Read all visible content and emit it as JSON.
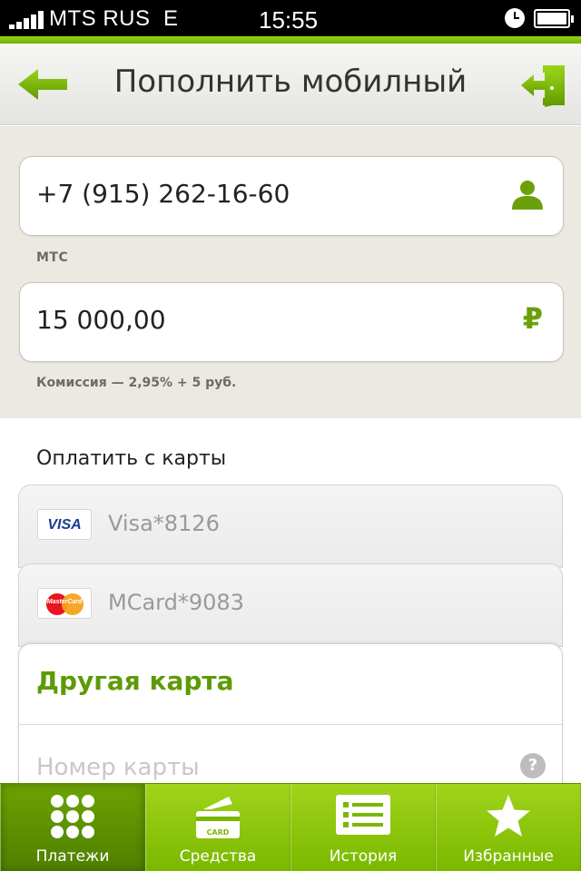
{
  "status_bar": {
    "carrier": "MTS RUS",
    "network": "E",
    "time": "15:55"
  },
  "nav": {
    "title": "Пополнить мобилный"
  },
  "form": {
    "phone_value": "+7 (915) 262-16-60",
    "operator": "МТС",
    "amount_value": "15 000,00",
    "currency_symbol": "₽",
    "commission": "Комиссия — 2,95% + 5 руб."
  },
  "cards": {
    "section_title": "Оплатить с карты",
    "items": [
      {
        "logo": "VISA",
        "name": "Visa*8126"
      },
      {
        "logo": "MasterCard",
        "name": "MCard*9083"
      }
    ],
    "other": {
      "title": "Другая карта",
      "card_number_placeholder": "Номер карты",
      "help_symbol": "?"
    }
  },
  "tabs": [
    {
      "label": "Платежи",
      "icon": "grid-icon",
      "active": true
    },
    {
      "label": "Средства",
      "icon": "card-icon",
      "active": false
    },
    {
      "label": "История",
      "icon": "list-icon",
      "active": false
    },
    {
      "label": "Избранные",
      "icon": "star-icon",
      "active": false
    }
  ],
  "colors": {
    "accent_green": "#6aa10a",
    "status_bar": "#000000",
    "form_bg": "#ece8e2"
  }
}
